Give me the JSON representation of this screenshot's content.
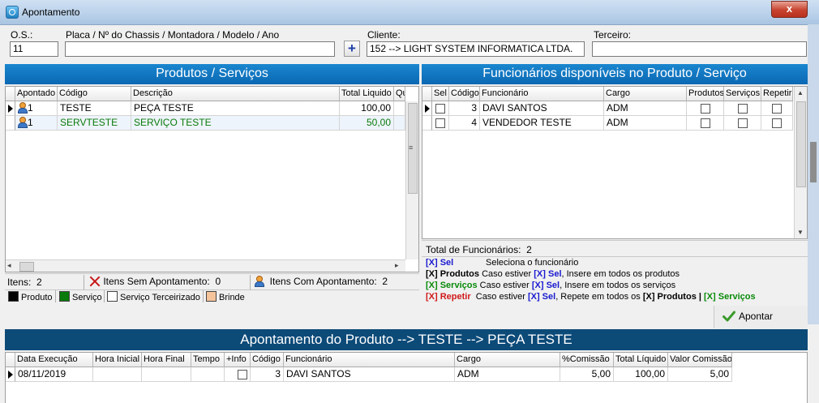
{
  "window": {
    "title": "Apontamento",
    "close_glyph": "x"
  },
  "header": {
    "os_label": "O.S.:",
    "os_value": "11",
    "placa_label": "Placa / Nº do Chassis / Montadora / Modelo / Ano",
    "placa_value": "",
    "add_glyph": "+",
    "cliente_label": "Cliente:",
    "cliente_value": "152 --> LIGHT SYSTEM INFORMATICA LTDA.",
    "terceiro_label": "Terceiro:",
    "terceiro_value": ""
  },
  "produtos": {
    "title": "Produtos / Serviços",
    "columns": [
      "Apontado",
      "Código",
      "Descrição",
      "Total Liquido",
      "Qu"
    ],
    "rows": [
      {
        "apontado": "1",
        "codigo": "TESTE",
        "descricao": "PEÇA TESTE",
        "total": "100,00",
        "kind": "produto"
      },
      {
        "apontado": "1",
        "codigo": "SERVTESTE",
        "descricao": "SERVIÇO TESTE",
        "total": "50,00",
        "kind": "servico"
      }
    ],
    "itens_label": "Itens:",
    "itens_value": "2",
    "sem_label": "Itens Sem Apontamento:",
    "sem_value": "0",
    "com_label": "Itens Com Apontamento:",
    "com_value": "2",
    "legend": [
      {
        "label": "Produto",
        "color": "#000000"
      },
      {
        "label": "Serviço",
        "color": "#0a7a0a"
      },
      {
        "label": "Serviço Terceirizado",
        "color": "#ffffff"
      },
      {
        "label": "Brinde",
        "color": "#f5c49a"
      }
    ]
  },
  "funcionarios": {
    "title": "Funcionários disponíveis no Produto / Serviço",
    "columns": [
      "Sel",
      "Código",
      "Funcionário",
      "Cargo",
      "Produtos",
      "Serviços",
      "Repetir"
    ],
    "rows": [
      {
        "codigo": "3",
        "nome": "DAVI SANTOS",
        "cargo": "ADM"
      },
      {
        "codigo": "4",
        "nome": "VENDEDOR TESTE",
        "cargo": "ADM"
      }
    ],
    "total_label": "Total de Funcionários:",
    "total_value": "2",
    "help": [
      {
        "tag": "[X] Sel",
        "desc": "Seleciona o funcionário"
      },
      {
        "tag": "[X] Produtos",
        "desc": "Caso estiver [X] Sel, Insere em todos os produtos"
      },
      {
        "tag": "[X] Serviços",
        "desc": "Caso estiver [X] Sel, Insere em todos os serviços"
      },
      {
        "tag": "[X] Repetir",
        "desc": "Caso estiver [X] Sel, Repete em todos os [X] Produtos | [X] Serviços"
      }
    ],
    "help_parts": {
      "caso": "Caso estiver",
      "xsel": "[X] Sel",
      "ins_prod": ", Insere em todos os produtos",
      "ins_serv": ", Insere em todos os serviços",
      "repete": ", Repete em todos os",
      "xprod": "[X] Produtos",
      "pipe": "|",
      "xserv": "[X] Serviços"
    },
    "apontar_label": "Apontar"
  },
  "apontamento": {
    "title": "Apontamento do Produto --> TESTE --> PEÇA TESTE",
    "columns": [
      "Data Execução",
      "Hora Inicial",
      "Hora Final",
      "Tempo",
      "+Info",
      "Código",
      "Funcionário",
      "Cargo",
      "%Comissão",
      "Total Líquido",
      "Valor Comissão"
    ],
    "rows": [
      {
        "data": "08/11/2019",
        "hora_inicial": "",
        "hora_final": "",
        "tempo": "",
        "codigo": "3",
        "funcionario": "DAVI SANTOS",
        "cargo": "ADM",
        "comissao_pct": "5,00",
        "total_liquido": "100,00",
        "valor_comissao": "5,00"
      }
    ]
  },
  "colors": {
    "header_blue": "#0b72c0",
    "dark_header": "#0c4a78",
    "servico_green": "#0a7a0a",
    "sel_blue": "#1a1ad0",
    "repetir_red": "#d01a1a"
  }
}
